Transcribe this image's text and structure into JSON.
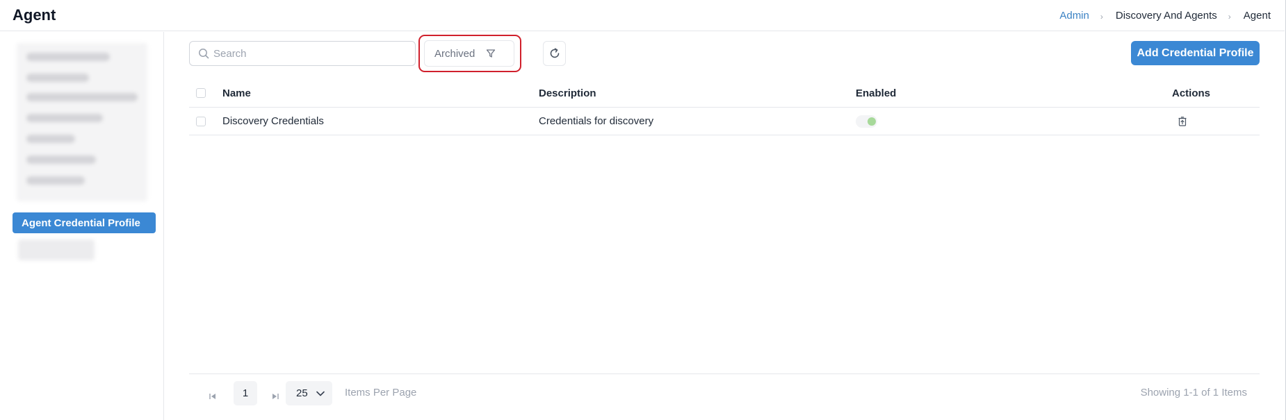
{
  "header": {
    "title": "Agent",
    "breadcrumb": {
      "admin": "Admin",
      "discovery": "Discovery And Agents",
      "current": "Agent",
      "separator": "›"
    }
  },
  "sidebar": {
    "active_item": "Agent Credential Profile"
  },
  "toolbar": {
    "search_placeholder": "Search",
    "filter_label": "Archived",
    "add_button": "Add Credential Profile"
  },
  "table": {
    "columns": {
      "name": "Name",
      "description": "Description",
      "enabled": "Enabled",
      "actions": "Actions"
    },
    "rows": [
      {
        "name": "Discovery Credentials",
        "description": "Credentials for discovery",
        "enabled": true
      }
    ]
  },
  "pagination": {
    "page": "1",
    "page_size": "25",
    "items_per_page_label": "Items Per Page",
    "summary": "Showing 1-1 of 1 Items"
  },
  "colors": {
    "accent": "#3b88d4",
    "highlight": "#d0202c",
    "toggle_on": "#a7d99a"
  },
  "icons": [
    "search-icon",
    "filter-icon",
    "refresh-icon",
    "unarchive-icon",
    "first-page-icon",
    "last-page-icon",
    "chevron-down-icon"
  ]
}
